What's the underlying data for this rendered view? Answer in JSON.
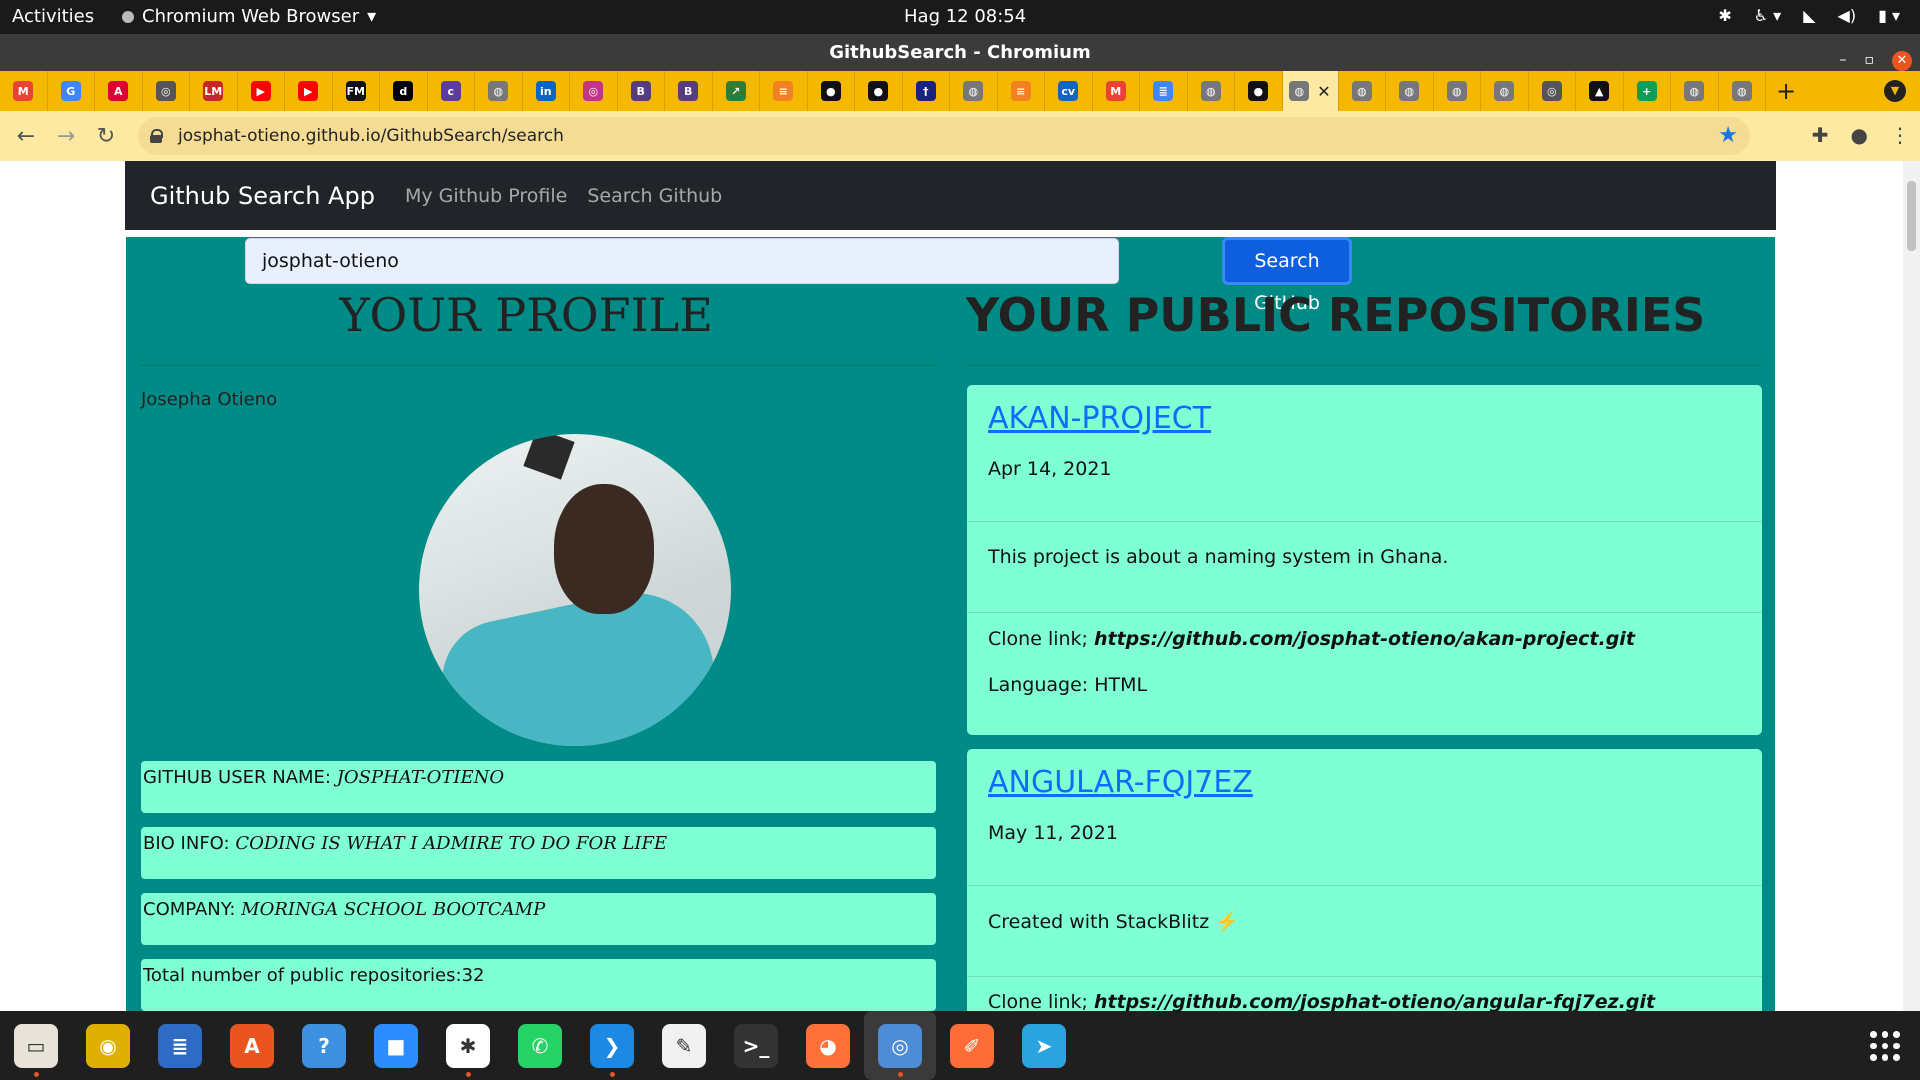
{
  "system": {
    "activities": "Activities",
    "app_name": "Chromium Web Browser",
    "clock": "Hag 12  08:54"
  },
  "window": {
    "title": "GithubSearch - Chromium"
  },
  "browser": {
    "url": "josphat-otieno.github.io/GithubSearch/search",
    "tabs": [
      {
        "icon": "gmail-icon",
        "glyph": "M",
        "color": "#ea4335"
      },
      {
        "icon": "google-icon",
        "glyph": "G",
        "color": "#4285f4"
      },
      {
        "icon": "angular-icon",
        "glyph": "A",
        "color": "#dd0031"
      },
      {
        "icon": "chromium-icon",
        "glyph": "◎",
        "color": "#555555"
      },
      {
        "icon": "lm-icon",
        "glyph": "LM",
        "color": "#c62828"
      },
      {
        "icon": "youtube-icon",
        "glyph": "▶",
        "color": "#ff0000"
      },
      {
        "icon": "youtube-icon",
        "glyph": "▶",
        "color": "#ff0000"
      },
      {
        "icon": "fm-icon",
        "glyph": "FM",
        "color": "#111111"
      },
      {
        "icon": "dev-icon",
        "glyph": "d",
        "color": "#000000"
      },
      {
        "icon": "coloraile-icon",
        "glyph": "c",
        "color": "#5c3d99"
      },
      {
        "icon": "globe-icon",
        "glyph": "◍",
        "color": "#777777"
      },
      {
        "icon": "linkedin-icon",
        "glyph": "in",
        "color": "#0a66c2"
      },
      {
        "icon": "instagram-icon",
        "glyph": "◎",
        "color": "#c13584"
      },
      {
        "icon": "bootstrap-icon",
        "glyph": "B",
        "color": "#563d7c"
      },
      {
        "icon": "bootstrap-icon",
        "glyph": "B",
        "color": "#563d7c"
      },
      {
        "icon": "chart-icon",
        "glyph": "↗",
        "color": "#2e7d32"
      },
      {
        "icon": "stack-icon",
        "glyph": "≡",
        "color": "#f48024"
      },
      {
        "icon": "github-icon",
        "glyph": "●",
        "color": "#111111"
      },
      {
        "icon": "github-icon",
        "glyph": "●",
        "color": "#111111"
      },
      {
        "icon": "heroku-icon",
        "glyph": "†",
        "color": "#1a237e"
      },
      {
        "icon": "globe-icon",
        "glyph": "◍",
        "color": "#777777"
      },
      {
        "icon": "stack-icon",
        "glyph": "≡",
        "color": "#f48024"
      },
      {
        "icon": "cv-icon",
        "glyph": "cv",
        "color": "#1565c0"
      },
      {
        "icon": "gmail-icon",
        "glyph": "M",
        "color": "#ea4335"
      },
      {
        "icon": "docs-icon",
        "glyph": "≣",
        "color": "#4285f4"
      },
      {
        "icon": "globe-icon",
        "glyph": "◍",
        "color": "#777777"
      },
      {
        "icon": "github-icon",
        "glyph": "●",
        "color": "#111111"
      }
    ],
    "tabs_after": [
      {
        "icon": "globe-icon",
        "glyph": "◍",
        "color": "#777777"
      },
      {
        "icon": "globe-icon",
        "glyph": "◍",
        "color": "#777777"
      },
      {
        "icon": "globe-icon",
        "glyph": "◍",
        "color": "#777777"
      },
      {
        "icon": "globe-icon",
        "glyph": "◍",
        "color": "#777777"
      },
      {
        "icon": "chromium-icon",
        "glyph": "◎",
        "color": "#555555"
      },
      {
        "icon": "graduation-icon",
        "glyph": "▲",
        "color": "#111111"
      },
      {
        "icon": "sheets-icon",
        "glyph": "+",
        "color": "#0f9d58"
      },
      {
        "icon": "globe-icon",
        "glyph": "◍",
        "color": "#777777"
      },
      {
        "icon": "globe-icon",
        "glyph": "◍",
        "color": "#777777"
      }
    ]
  },
  "app": {
    "brand": "Github Search App",
    "nav": [
      "My Github Profile",
      "Search Github"
    ],
    "search_value": "josphat-otieno",
    "search_button": "Search GitHub",
    "profile_heading": "YOUR PROFILE",
    "repos_heading": "YOUR PUBLIC REPOSITORIES",
    "profile": {
      "name": "Josepha Otieno",
      "fields": [
        {
          "label": "GITHUB USER NAME: ",
          "value": "JOSPHAT-OTIENO"
        },
        {
          "label": "BIO INFO: ",
          "value": "CODING IS WHAT I ADMIRE TO DO FOR LIFE"
        },
        {
          "label": "COMPANY: ",
          "value": "MORINGA SCHOOL BOOTCAMP"
        },
        {
          "label": "Total number of public repositories:32",
          "value": ""
        }
      ]
    },
    "repos": [
      {
        "name": "AKAN-PROJECT",
        "date": "Apr 14, 2021",
        "description": "This project is about a naming system in Ghana.",
        "clone_label": "Clone link; ",
        "clone_url": "https://github.com/josphat-otieno/akan-project.git",
        "language": "Language: HTML"
      },
      {
        "name": "ANGULAR-FQJ7EZ",
        "date": "May 11, 2021",
        "description": "Created with StackBlitz ⚡️",
        "clone_label": "Clone link; ",
        "clone_url": "https://github.com/josphat-otieno/angular-fqj7ez.git",
        "language": ""
      }
    ]
  },
  "colors": {
    "page_teal": "#008b87",
    "card_aqua": "#7fffd4",
    "navbar_dark": "#212529",
    "link_blue": "#0d6efd",
    "button_blue": "#0d5fe0",
    "tab_yellow": "#f5b800"
  },
  "dock": [
    {
      "icon": "files-icon",
      "color": "#e8e3d8",
      "glyph": "▭",
      "pip": true
    },
    {
      "icon": "rhythmbox-icon",
      "color": "#e0b000",
      "glyph": "◉",
      "pip": false
    },
    {
      "icon": "writer-icon",
      "color": "#2d6bc4",
      "glyph": "≣",
      "pip": false
    },
    {
      "icon": "software-icon",
      "color": "#e95420",
      "glyph": "A",
      "pip": false
    },
    {
      "icon": "help-icon",
      "color": "#3d8fe0",
      "glyph": "?",
      "pip": false
    },
    {
      "icon": "zoom-icon",
      "color": "#2d8cff",
      "glyph": "■",
      "pip": false
    },
    {
      "icon": "slack-icon",
      "color": "#ffffff",
      "glyph": "✱",
      "pip": true
    },
    {
      "icon": "whatsapp-icon",
      "color": "#25d366",
      "glyph": "✆",
      "pip": false
    },
    {
      "icon": "vscode-icon",
      "color": "#1e88e5",
      "glyph": "❯",
      "pip": true
    },
    {
      "icon": "texteditor-icon",
      "color": "#f0f0f0",
      "glyph": "✎",
      "pip": false
    },
    {
      "icon": "terminal-icon",
      "color": "#333333",
      "glyph": ">_",
      "pip": false
    },
    {
      "icon": "firefox-icon",
      "color": "#ff7139",
      "glyph": "◕",
      "pip": false
    },
    {
      "icon": "chromium-icon",
      "color": "#4f8cd6",
      "glyph": "◎",
      "pip": true
    },
    {
      "icon": "postman-icon",
      "color": "#ff6c37",
      "glyph": "✐",
      "pip": false
    },
    {
      "icon": "telegram-icon",
      "color": "#2aa3df",
      "glyph": "➤",
      "pip": false
    }
  ]
}
